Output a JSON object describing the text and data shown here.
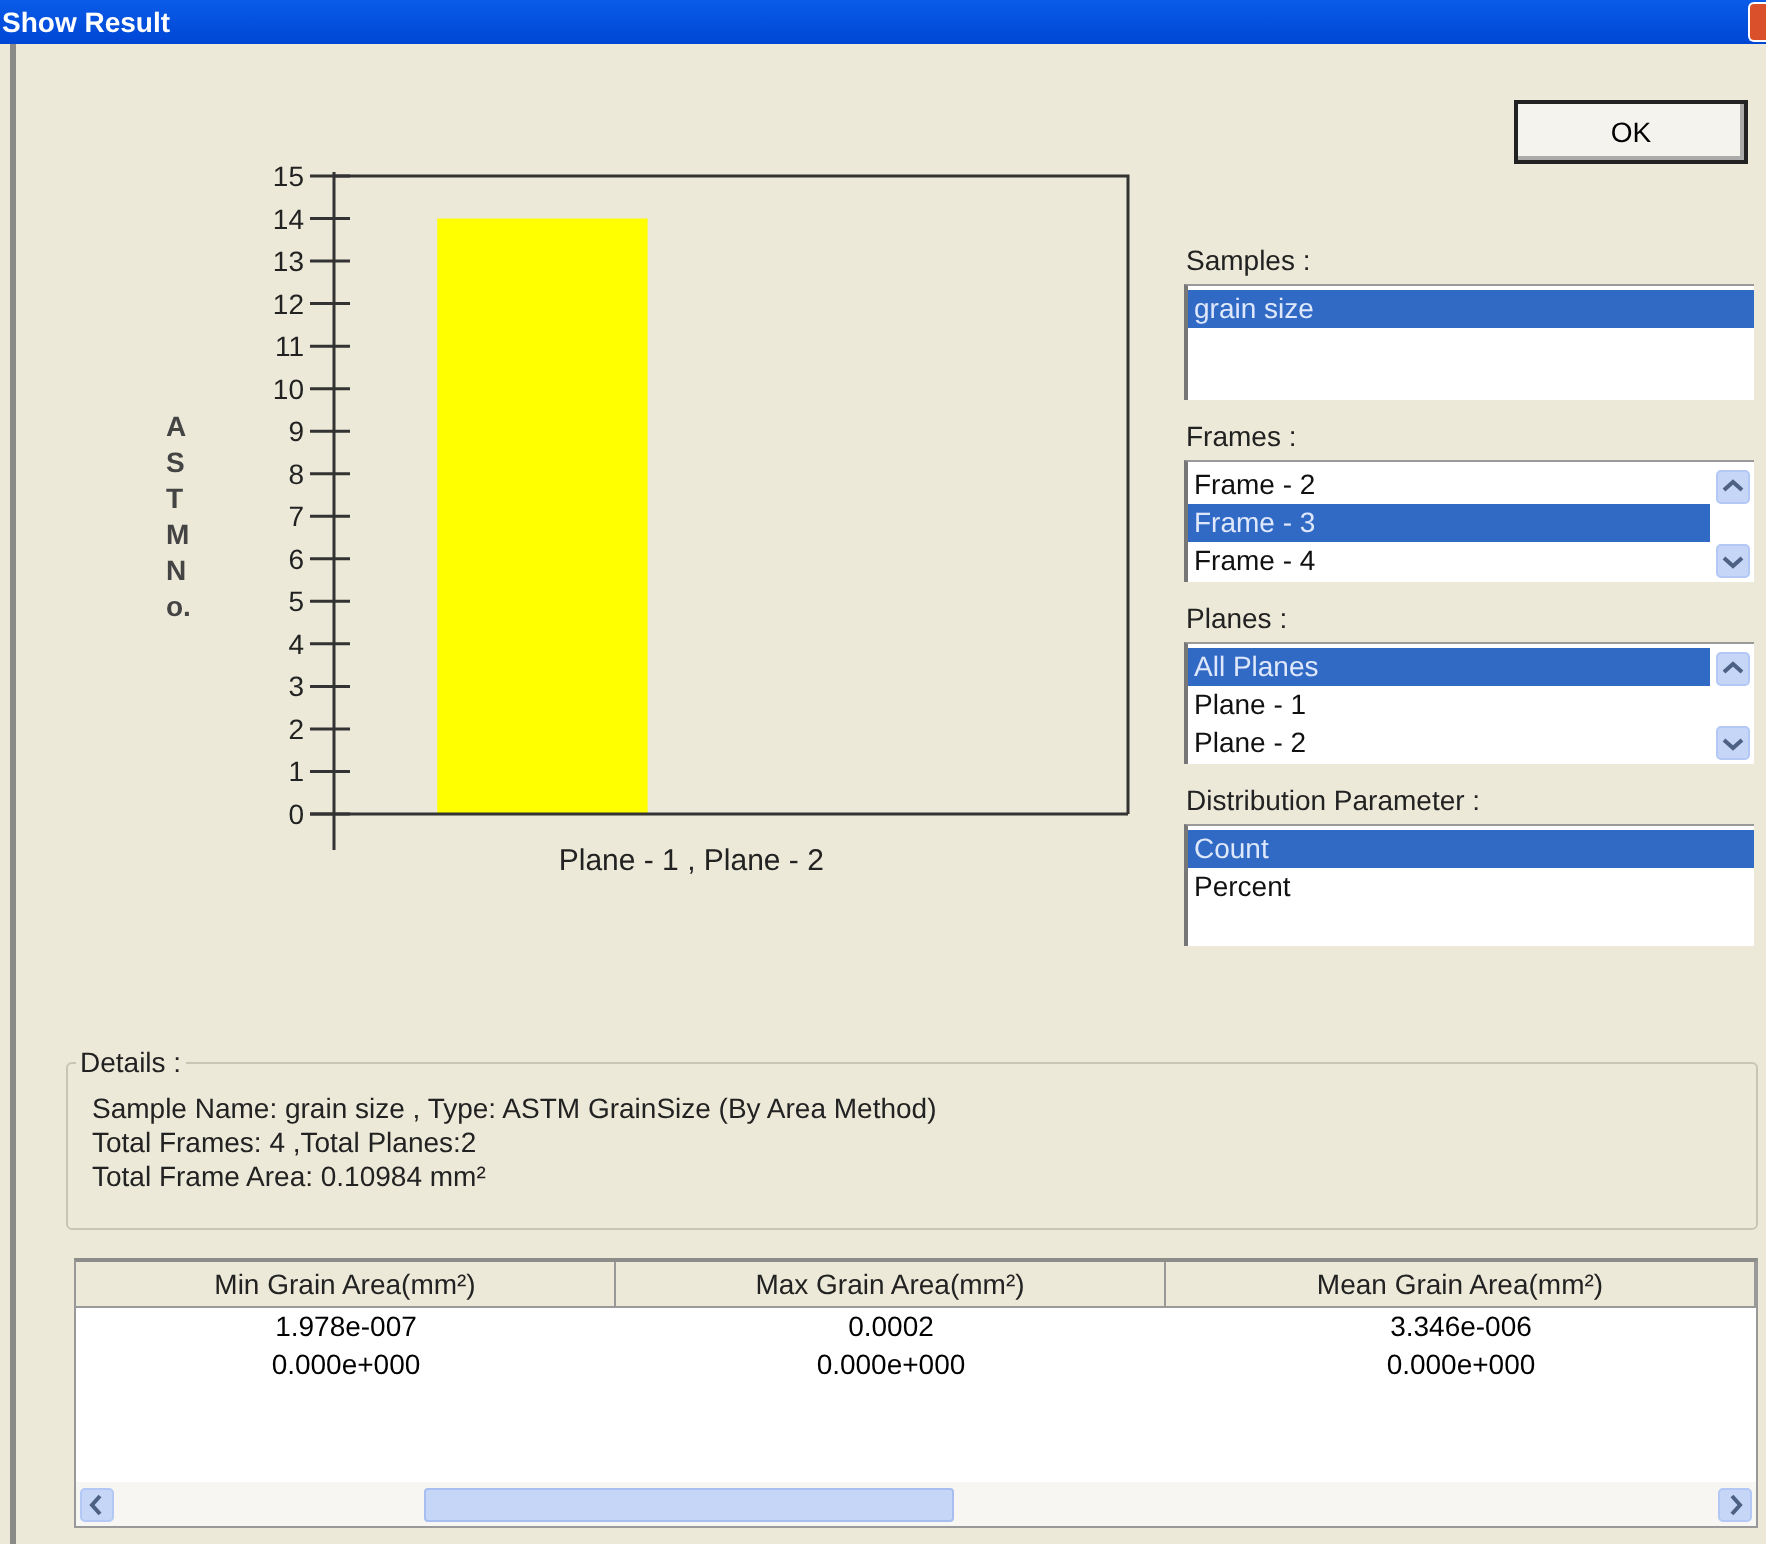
{
  "window": {
    "title": "Show Result"
  },
  "chart": {
    "chart_data": {
      "type": "bar",
      "ylabel": "ASTM No.",
      "categories": [
        "Plane - 1 , Plane - 2"
      ],
      "series": [
        {
          "color": "#ffff00",
          "values": [
            14
          ]
        }
      ],
      "ylim": [
        0,
        15
      ],
      "yticks": [
        0,
        1,
        2,
        3,
        4,
        5,
        6,
        7,
        8,
        9,
        10,
        11,
        12,
        13,
        14,
        15
      ]
    }
  },
  "ok_button": "OK",
  "lists": [
    {
      "label": "Samples :",
      "scrollable": false,
      "items": [
        {
          "text": "grain size",
          "selected": true
        }
      ]
    },
    {
      "label": "Frames :",
      "scrollable": true,
      "items": [
        {
          "text": "Frame - 2",
          "selected": false
        },
        {
          "text": "Frame - 3",
          "selected": true
        },
        {
          "text": "Frame - 4",
          "selected": false
        }
      ]
    },
    {
      "label": "Planes :",
      "scrollable": true,
      "items": [
        {
          "text": "All Planes",
          "selected": true
        },
        {
          "text": "Plane - 1",
          "selected": false
        },
        {
          "text": "Plane - 2",
          "selected": false
        }
      ]
    },
    {
      "label": "Distribution Parameter :",
      "scrollable": false,
      "items": [
        {
          "text": "Count",
          "selected": true
        },
        {
          "text": "Percent",
          "selected": false
        }
      ]
    }
  ],
  "details": {
    "label": "Details :",
    "lines": [
      "Sample Name: grain size , Type: ASTM GrainSize (By Area Method)",
      "Total Frames: 4 ,Total Planes:2",
      "Total Frame Area: 0.10984 mm²"
    ]
  },
  "table": {
    "columns": [
      "Min Grain Area(mm²)",
      "Max Grain Area(mm²)",
      "Mean Grain Area(mm²)"
    ],
    "rows": [
      [
        "1.978e-007",
        "0.0002",
        "3.346e-006"
      ],
      [
        "0.000e+000",
        "0.000e+000",
        "0.000e+000"
      ]
    ]
  }
}
